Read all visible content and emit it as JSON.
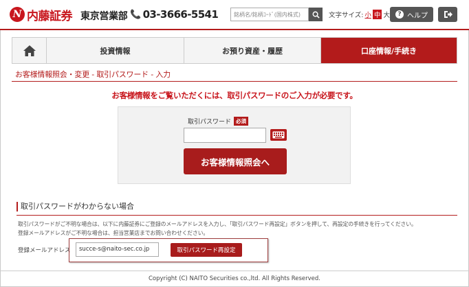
{
  "header": {
    "logo_text": "内藤証券",
    "branch": "東京営業部",
    "phone": "03-3666-5541",
    "search_placeholder": "銘柄名/銘柄ｺｰﾄﾞ(国内株式)",
    "font_size_label": "文字サイズ:",
    "font_size_small": "小",
    "font_size_mid": "中",
    "font_size_large": "大",
    "help_label": "ヘルプ",
    "accent_color": "#b31b1b"
  },
  "nav": {
    "home_icon": "home-icon",
    "tabs": [
      {
        "label": "投資情報"
      },
      {
        "label": "お預り資産・履歴"
      },
      {
        "label": "口座情報/手続き"
      }
    ]
  },
  "breadcrumb": "お客様情報照会・変更 - 取引パスワード - 入力",
  "notice": "お客様情報をご覧いただくには、取引パスワードのご入力が必要です。",
  "password_form": {
    "label": "取引パスワード",
    "required_badge": "必須",
    "value": "",
    "keyboard_icon": "keyboard-icon",
    "submit_label": "お客様情報照会へ"
  },
  "forgot": {
    "title": "取引パスワードがわからない場合",
    "desc_line1": "取引パスワードがご不明な場合は、以下に内藤証券にご登録のメールアドレスを入力し、「取引パスワード再設定」ボタンを押して、再設定の手続きを行ってください。",
    "desc_line2": "登録メールアドレスがご不明な場合は、担当営業店までお問い合わせください。",
    "email_label": "登録メールアドレス",
    "email_value": "succe-s@naito-sec.co.jp",
    "reset_label": "取引パスワード再設定"
  },
  "footer": "Copyright (C) NAITO Securities co.,ltd. All Rights Reserved."
}
